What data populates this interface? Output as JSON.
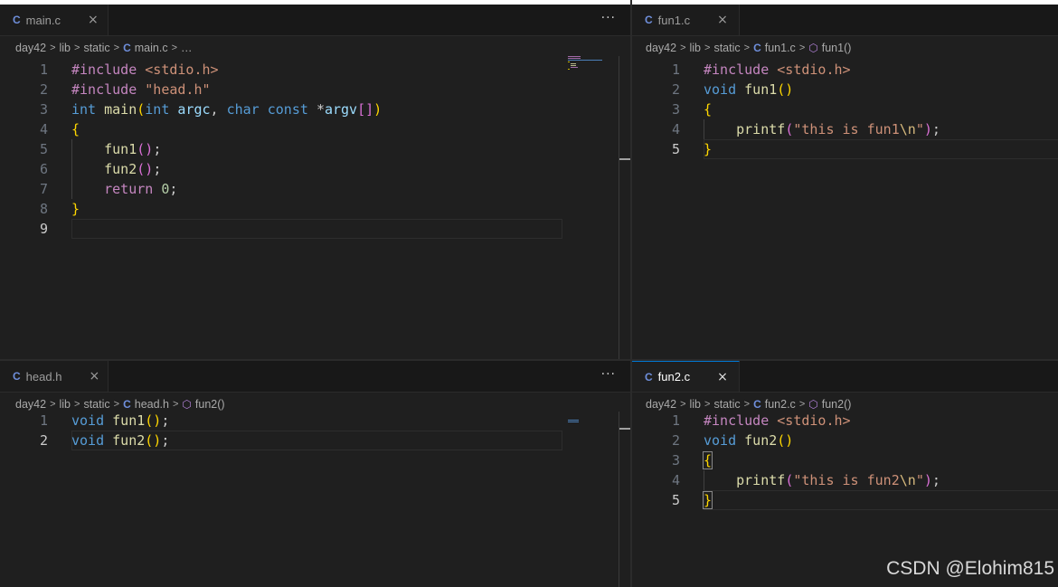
{
  "panes": {
    "top_left": {
      "tab": {
        "icon": "C",
        "name": "main.c",
        "close": "×"
      },
      "more": "···",
      "breadcrumb": {
        "folder1": "day42",
        "folder2": "lib",
        "folder3": "static",
        "file": "main.c",
        "tail": "…"
      },
      "line_numbers": [
        "1",
        "2",
        "3",
        "4",
        "5",
        "6",
        "7",
        "8",
        "9"
      ]
    },
    "top_right": {
      "tab": {
        "icon": "C",
        "name": "fun1.c",
        "close": "×"
      },
      "breadcrumb": {
        "folder1": "day42",
        "folder2": "lib",
        "folder3": "static",
        "file": "fun1.c",
        "symbol": "fun1()"
      },
      "line_numbers": [
        "1",
        "2",
        "3",
        "4",
        "5"
      ]
    },
    "bottom_left": {
      "tab": {
        "icon": "C",
        "name": "head.h",
        "close": "×"
      },
      "more": "···",
      "breadcrumb": {
        "folder1": "day42",
        "folder2": "lib",
        "folder3": "static",
        "file": "head.h",
        "symbol": "fun2()"
      },
      "line_numbers": [
        "1",
        "2"
      ]
    },
    "bottom_right": {
      "tab": {
        "icon": "C",
        "name": "fun2.c",
        "close": "×"
      },
      "breadcrumb": {
        "folder1": "day42",
        "folder2": "lib",
        "folder3": "static",
        "file": "fun2.c",
        "symbol": "fun2()"
      },
      "line_numbers": [
        "1",
        "2",
        "3",
        "4",
        "5"
      ]
    }
  },
  "code": {
    "main_c": [
      [
        [
          "dir",
          "#include "
        ],
        [
          "str",
          "<stdio.h>"
        ]
      ],
      [
        [
          "dir",
          "#include "
        ],
        [
          "str",
          "\"head.h\""
        ]
      ],
      [
        [
          "type",
          "int "
        ],
        [
          "fn",
          "main"
        ],
        [
          "br1",
          "("
        ],
        [
          "type",
          "int "
        ],
        [
          "var",
          "argc"
        ],
        [
          "plain",
          ", "
        ],
        [
          "type",
          "char const "
        ],
        [
          "plain",
          "*"
        ],
        [
          "var",
          "argv"
        ],
        [
          "br2",
          "[]"
        ],
        [
          "br1",
          ")"
        ]
      ],
      [
        [
          "br1",
          "{"
        ]
      ],
      [
        [
          "plain",
          "    "
        ],
        [
          "fn",
          "fun1"
        ],
        [
          "br2",
          "()"
        ],
        [
          "plain",
          ";"
        ]
      ],
      [
        [
          "plain",
          "    "
        ],
        [
          "fn",
          "fun2"
        ],
        [
          "br2",
          "()"
        ],
        [
          "plain",
          ";"
        ]
      ],
      [
        [
          "plain",
          "    "
        ],
        [
          "ctl",
          "return "
        ],
        [
          "num",
          "0"
        ],
        [
          "plain",
          ";"
        ]
      ],
      [
        [
          "br1",
          "}"
        ]
      ],
      []
    ],
    "fun1_c": [
      [
        [
          "dir",
          "#include "
        ],
        [
          "str",
          "<stdio.h>"
        ]
      ],
      [
        [
          "type",
          "void "
        ],
        [
          "fn",
          "fun1"
        ],
        [
          "br1",
          "()"
        ]
      ],
      [
        [
          "br1",
          "{"
        ]
      ],
      [
        [
          "plain",
          "    "
        ],
        [
          "fn",
          "printf"
        ],
        [
          "br2",
          "("
        ],
        [
          "str",
          "\"this is fun1"
        ],
        [
          "esc",
          "\\n"
        ],
        [
          "str",
          "\""
        ],
        [
          "br2",
          ")"
        ],
        [
          "plain",
          ";"
        ]
      ],
      [
        [
          "br1",
          "}"
        ]
      ]
    ],
    "head_h": [
      [
        [
          "type",
          "void "
        ],
        [
          "fn",
          "fun1"
        ],
        [
          "br1",
          "()"
        ],
        [
          "plain",
          ";"
        ]
      ],
      [
        [
          "type",
          "void "
        ],
        [
          "fn",
          "fun2"
        ],
        [
          "br1",
          "()"
        ],
        [
          "plain",
          ";"
        ]
      ]
    ],
    "fun2_c": [
      [
        [
          "dir",
          "#include "
        ],
        [
          "str",
          "<stdio.h>"
        ]
      ],
      [
        [
          "type",
          "void "
        ],
        [
          "fn",
          "fun2"
        ],
        [
          "br1",
          "()"
        ]
      ],
      [
        [
          "br1",
          "{"
        ]
      ],
      [
        [
          "plain",
          "    "
        ],
        [
          "fn",
          "printf"
        ],
        [
          "br2",
          "("
        ],
        [
          "str",
          "\"this is fun2"
        ],
        [
          "esc",
          "\\n"
        ],
        [
          "str",
          "\""
        ],
        [
          "br2",
          ")"
        ],
        [
          "plain",
          ";"
        ]
      ],
      [
        [
          "br1",
          "}"
        ]
      ]
    ]
  },
  "watermark": "CSDN @Elohim815",
  "colors": {
    "editor_bg": "#1f1f1f",
    "tab_bar_bg": "#181818",
    "active_tab_border": "#0078d4",
    "c_icon": "#6f8fdc"
  }
}
